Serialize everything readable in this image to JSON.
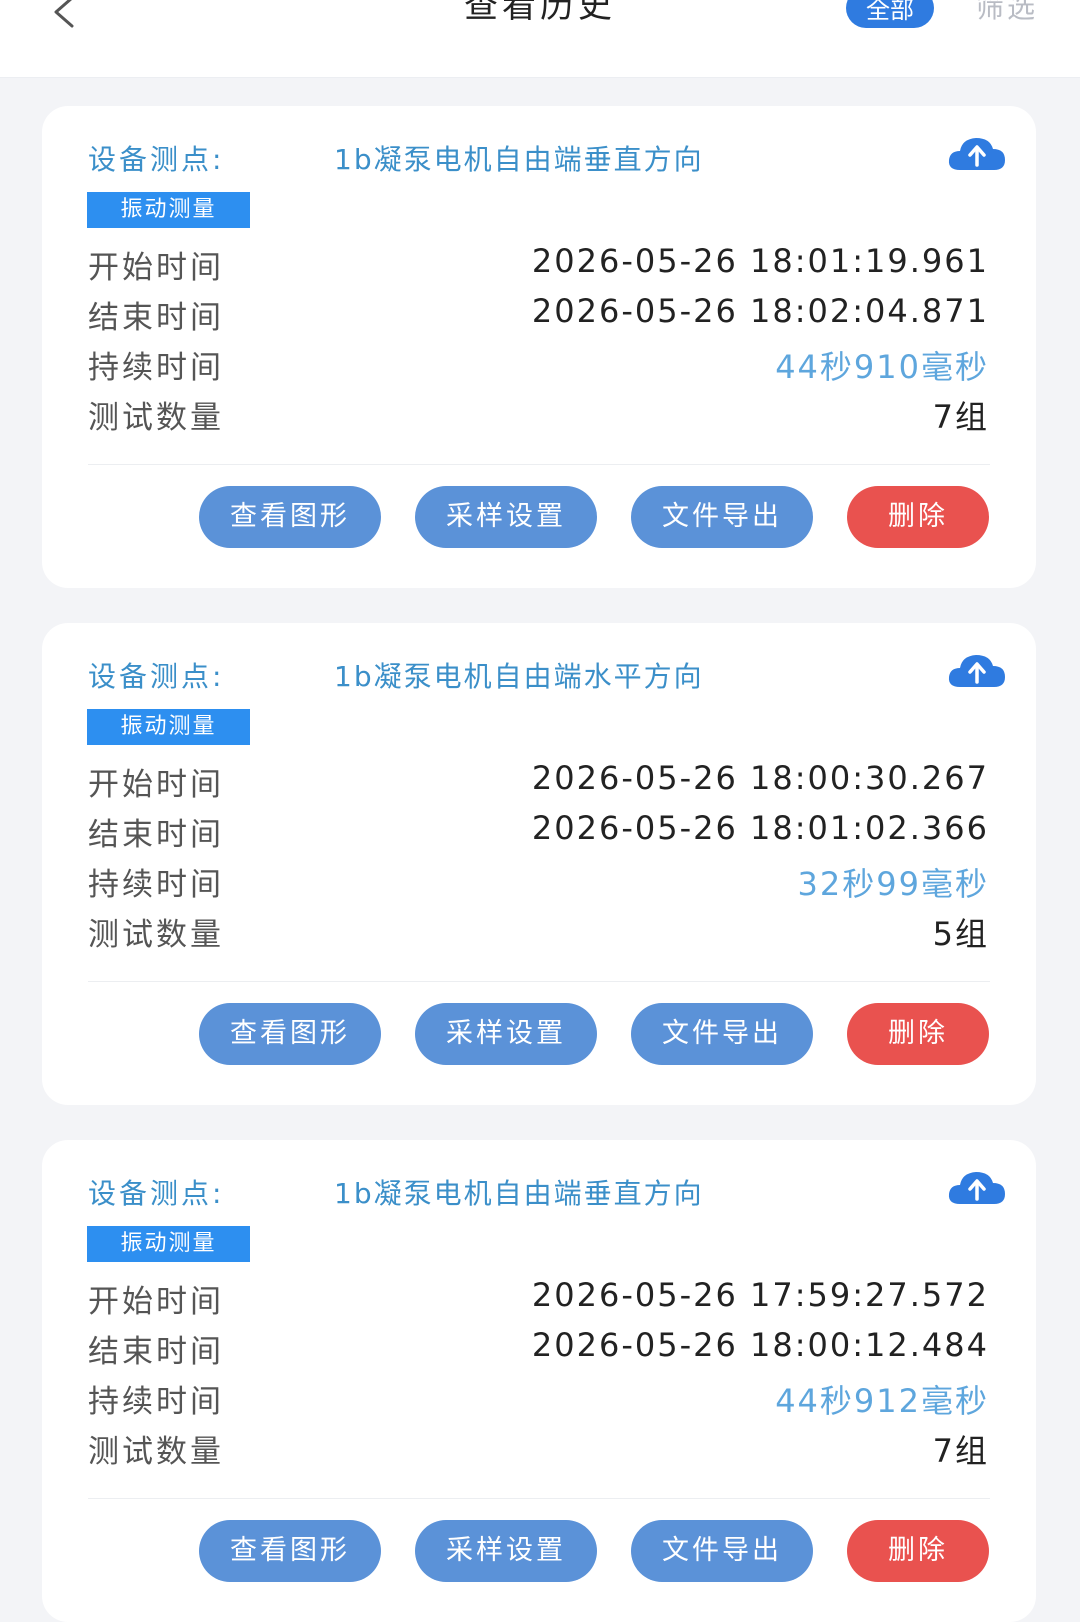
{
  "header": {
    "title": "查看历史",
    "all_label": "全部",
    "filter_label": "筛选"
  },
  "labels": {
    "point": "设备测点:",
    "start": "开始时间",
    "end": "结束时间",
    "duration": "持续时间",
    "count": "测试数量"
  },
  "actions": {
    "view_chart": "查看图形",
    "sampling": "采样设置",
    "export": "文件导出",
    "delete": "删除"
  },
  "colors": {
    "accent": "#3b8fc9",
    "button": "#5b92d8",
    "delete": "#e9524f",
    "tag": "#2d8ff0"
  },
  "records": [
    {
      "point": "1b凝泵电机自由端垂直方向",
      "tag": "振动测量",
      "start": "2026-05-26 18:01:19.961",
      "end": "2026-05-26 18:02:04.871",
      "duration": "44秒910毫秒",
      "count": "7组"
    },
    {
      "point": "1b凝泵电机自由端水平方向",
      "tag": "振动测量",
      "start": "2026-05-26 18:00:30.267",
      "end": "2026-05-26 18:01:02.366",
      "duration": "32秒99毫秒",
      "count": "5组"
    },
    {
      "point": "1b凝泵电机自由端垂直方向",
      "tag": "振动测量",
      "start": "2026-05-26 17:59:27.572",
      "end": "2026-05-26 18:00:12.484",
      "duration": "44秒912毫秒",
      "count": "7组"
    }
  ]
}
